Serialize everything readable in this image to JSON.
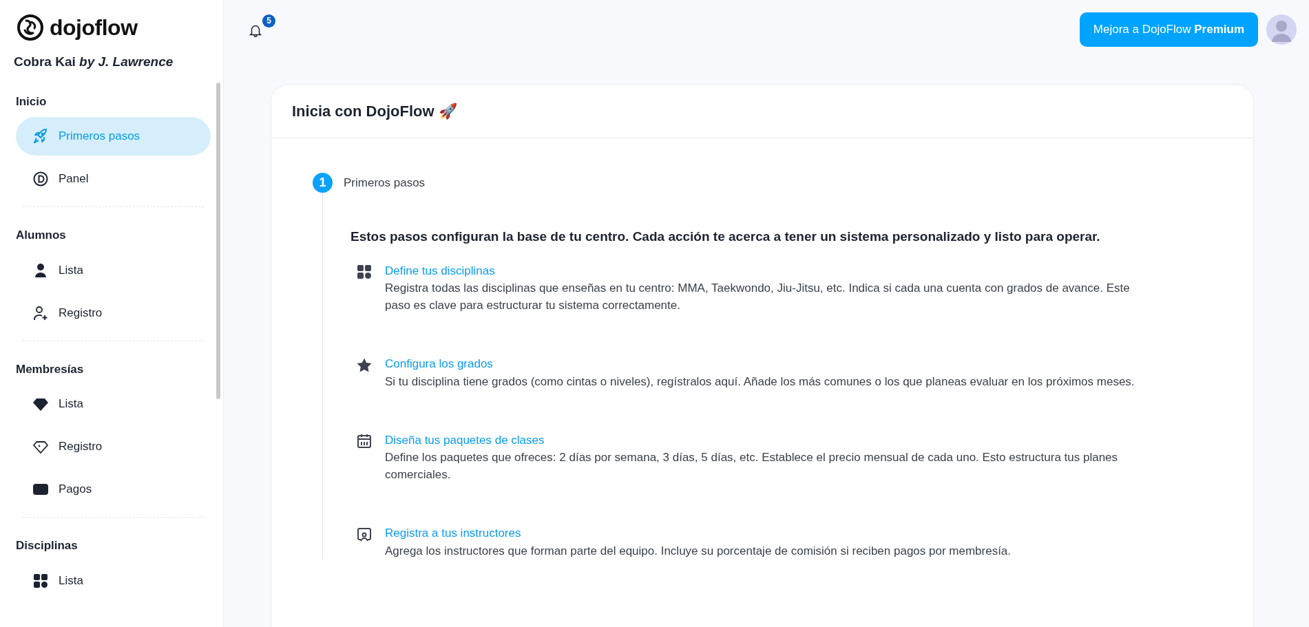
{
  "sidebar": {
    "brand": "dojoflow",
    "org": {
      "name": "Cobra Kai",
      "by": "by J. Lawrence"
    },
    "sections": [
      {
        "title": "Inicio",
        "items": [
          {
            "label": "Primeros pasos",
            "selected": true
          },
          {
            "label": "Panel",
            "selected": false
          }
        ]
      },
      {
        "title": "Alumnos",
        "items": [
          {
            "label": "Lista",
            "selected": false
          },
          {
            "label": "Registro",
            "selected": false
          }
        ]
      },
      {
        "title": "Membresías",
        "items": [
          {
            "label": "Lista",
            "selected": false
          },
          {
            "label": "Registro",
            "selected": false
          },
          {
            "label": "Pagos",
            "selected": false
          }
        ]
      },
      {
        "title": "Disciplinas",
        "items": [
          {
            "label": "Lista",
            "selected": false
          }
        ]
      }
    ]
  },
  "topbar": {
    "notifications": "5",
    "upgrade_button": "Mejora a DojoFlow **Premium**"
  },
  "card": {
    "title": "Inicia con DojoFlow 🚀",
    "step": {
      "number": "1",
      "label": "Primeros pasos"
    },
    "intro": "Estos pasos configuran la base de tu centro. Cada acción te acerca a tener un sistema personalizado y listo para operar.",
    "tasks": [
      {
        "title": "Define tus disciplinas",
        "text": "Registra todas las disciplinas que enseñas en tu centro: MMA, Taekwondo, Jiu-Jitsu, etc. Indica si cada una cuenta con grados de avance. Este paso es clave para estructurar tu sistema correctamente."
      },
      {
        "title": "Configura los grados",
        "text": "Si tu disciplina tiene grados (como cintas o niveles), regístralos aquí. Añade los más comunes o los que planeas evaluar en los próximos meses."
      },
      {
        "title": "Diseña tus paquetes de clases",
        "text": "Define los paquetes que ofreces: 2 días por semana, 3 días, 5 días, etc. Establece el precio mensual de cada uno. Esto estructura tus planes comerciales."
      },
      {
        "title": "Registra a tus instructores",
        "text": "Agrega los instructores que forman parte del equipo. Incluye su porcentaje de comisión si reciben pagos por membresía."
      }
    ]
  }
}
